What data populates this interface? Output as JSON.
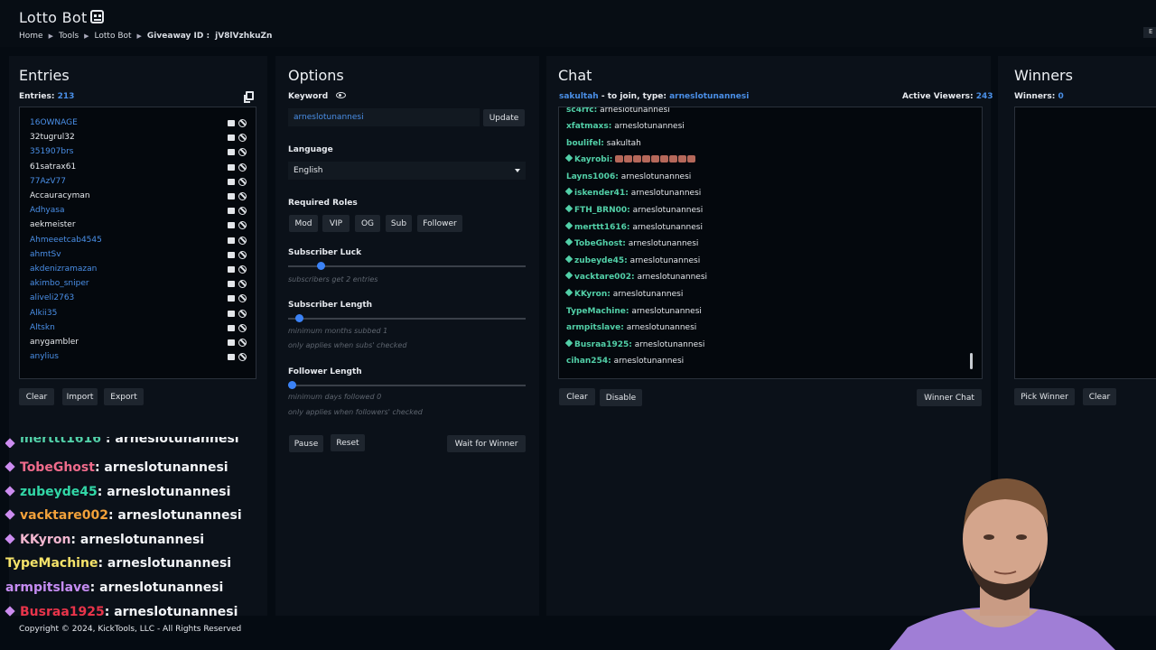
{
  "app": {
    "title": "Lotto Bot"
  },
  "breadcrumb": {
    "home": "Home",
    "tools": "Tools",
    "lotto": "Lotto Bot",
    "giveaway_label": "Giveaway ID :",
    "giveaway_id": "jV8lVzhkuZn"
  },
  "edge_tag": "E",
  "entries": {
    "title": "Entries",
    "count_label": "Entries:",
    "count": "213",
    "items": [
      {
        "name": "16OWNAGE",
        "color": "link"
      },
      {
        "name": "32tugrul32",
        "color": "white"
      },
      {
        "name": "351907brs",
        "color": "link"
      },
      {
        "name": "61satrax61",
        "color": "white"
      },
      {
        "name": "77AzV77",
        "color": "link"
      },
      {
        "name": "Accauracyman",
        "color": "white"
      },
      {
        "name": "Adhyasa",
        "color": "link"
      },
      {
        "name": "aekmeister",
        "color": "white"
      },
      {
        "name": "Ahmeeetcab4545",
        "color": "link"
      },
      {
        "name": "ahmtSv",
        "color": "link"
      },
      {
        "name": "akdenizramazan",
        "color": "link"
      },
      {
        "name": "akimbo_sniper",
        "color": "link"
      },
      {
        "name": "aliveli2763",
        "color": "link"
      },
      {
        "name": "Alkii35",
        "color": "link"
      },
      {
        "name": "Altskn",
        "color": "link"
      },
      {
        "name": "anygambler",
        "color": "white"
      },
      {
        "name": "anylius",
        "color": "link"
      }
    ],
    "buttons": {
      "clear": "Clear",
      "import": "Import",
      "export": "Export"
    }
  },
  "options": {
    "title": "Options",
    "keyword_label": "Keyword",
    "keyword_value": "arneslotunannesi",
    "update_label": "Update",
    "language_label": "Language",
    "language_value": "English",
    "roles_label": "Required Roles",
    "roles": [
      "Mod",
      "VIP",
      "OG",
      "Sub",
      "Follower"
    ],
    "sub_luck_label": "Subscriber Luck",
    "sub_luck_hint": "subscribers get 2 entries",
    "sub_luck_fraction": 0.12,
    "sub_length_label": "Subscriber Length",
    "sub_length_hint1": "minimum months subbed 1",
    "sub_length_hint2": "only applies when subs' checked",
    "sub_length_fraction": 0.03,
    "follow_length_label": "Follower Length",
    "follow_length_hint1": "minimum days followed 0",
    "follow_length_hint2": "only applies when followers' checked",
    "follow_length_fraction": 0.0,
    "pause_label": "Pause",
    "reset_label": "Reset",
    "wait_label": "Wait for Winner"
  },
  "chat": {
    "title": "Chat",
    "channel": "sakultah",
    "join_text": "- to join, type:",
    "join_keyword": "arneslotunannesi",
    "viewers_label": "Active Viewers:",
    "viewers": "243",
    "messages": [
      {
        "user": "xfatmaxs:",
        "msg": "arneslotunannesi",
        "color": "#52d0a8",
        "badge": false
      },
      {
        "user": "boulifel:",
        "msg": "sakultah",
        "color": "#52d0a8",
        "badge": false
      },
      {
        "user": "Kayrobi:",
        "msg": "",
        "color": "#52d0a8",
        "badge": true,
        "emotes": 9
      },
      {
        "user": "Layns1006:",
        "msg": "arneslotunannesi",
        "color": "#52d0a8",
        "badge": false
      },
      {
        "user": "iskender41:",
        "msg": "arneslotunannesi",
        "color": "#52d0a8",
        "badge": true
      },
      {
        "user": "FTH_BRN00:",
        "msg": "arneslotunannesi",
        "color": "#52d0a8",
        "badge": true
      },
      {
        "user": "merttt1616:",
        "msg": "arneslotunannesi",
        "color": "#52d0a8",
        "badge": true
      },
      {
        "user": "TobeGhost:",
        "msg": "arneslotunannesi",
        "color": "#52d0a8",
        "badge": true
      },
      {
        "user": "zubeyde45:",
        "msg": "arneslotunannesi",
        "color": "#52d0a8",
        "badge": true
      },
      {
        "user": "vacktare002:",
        "msg": "arneslotunannesi",
        "color": "#52d0a8",
        "badge": true
      },
      {
        "user": "KKyron:",
        "msg": "arneslotunannesi",
        "color": "#52d0a8",
        "badge": true
      },
      {
        "user": "TypeMachine:",
        "msg": "arneslotunannesi",
        "color": "#52d0a8",
        "badge": false
      },
      {
        "user": "armpitslave:",
        "msg": "arneslotunannesi",
        "color": "#52d0a8",
        "badge": false
      },
      {
        "user": "Busraa1925:",
        "msg": "arneslotunannesi",
        "color": "#52d0a8",
        "badge": true
      },
      {
        "user": "cihan254:",
        "msg": "arneslotunannesi",
        "color": "#52d0a8",
        "badge": false
      }
    ],
    "clear_label": "Clear",
    "disable_label": "Disable",
    "winner_chat_label": "Winner Chat"
  },
  "winners": {
    "title": "Winners",
    "count_label": "Winners:",
    "count": "0",
    "pick_label": "Pick Winner",
    "clear_label": "Clear"
  },
  "overlay": {
    "lines": [
      {
        "user": "TobeGhost",
        "msg": ": arneslotunannesi",
        "color": "#ef6b8b",
        "diamond": true
      },
      {
        "user": "zubeyde45",
        "msg": ": arneslotunannesi",
        "color": "#32d6a6",
        "diamond": true
      },
      {
        "user": "vacktare002",
        "msg": ": arneslotunannesi",
        "color": "#f2a13a",
        "diamond": true
      },
      {
        "user": "KKyron",
        "msg": ": arneslotunannesi",
        "color": "#f2b6cf",
        "diamond": true
      },
      {
        "user": "TypeMachine",
        "msg": ": arneslotunannesi",
        "color": "#f5e36a",
        "diamond": false
      },
      {
        "user": "armpitslave",
        "msg": ": arneslotunannesi",
        "color": "#c58cf2",
        "diamond": false
      },
      {
        "user": "Busraa1925",
        "msg": ": arneslotunannesi",
        "color": "#e8344a",
        "diamond": true
      }
    ]
  },
  "footer": {
    "text": "Copyright © 2024, KickTools, LLC - All Rights Reserved"
  },
  "colors": {
    "accent": "#4a8fe7",
    "background": "#050b12",
    "panel": "#0b1119",
    "chat_user": "#52d0a8"
  }
}
